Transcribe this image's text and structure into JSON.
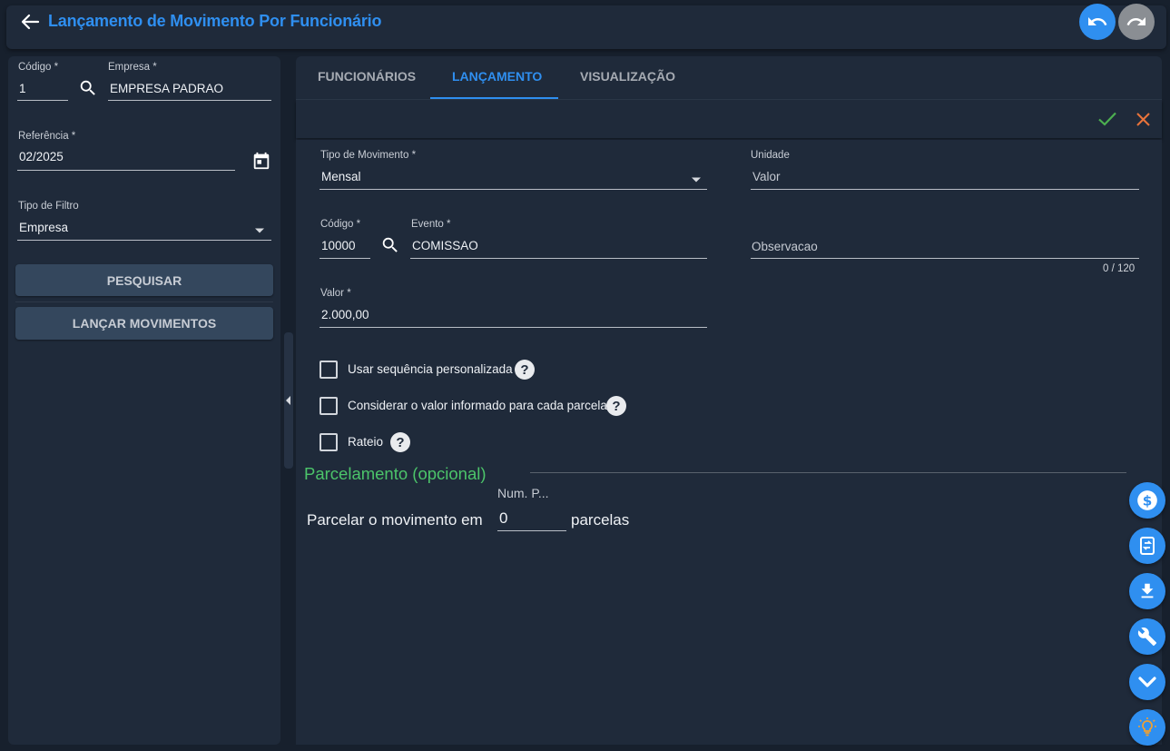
{
  "header": {
    "title": "Lançamento de Movimento Por Funcionário"
  },
  "filters": {
    "codigo_label": "Código *",
    "codigo_value": "1",
    "empresa_label": "Empresa *",
    "empresa_value": "EMPRESA PADRAO",
    "referencia_label": "Referência *",
    "referencia_value": "02/2025",
    "tipo_filtro_label": "Tipo de Filtro",
    "tipo_filtro_value": "Empresa",
    "pesquisar_label": "PESQUISAR",
    "lancar_label": "LANÇAR MOVIMENTOS"
  },
  "tabs": [
    {
      "label": "FUNCIONÁRIOS"
    },
    {
      "label": "LANÇAMENTO"
    },
    {
      "label": "VISUALIZAÇÃO"
    }
  ],
  "form": {
    "tipo_movimento_label": "Tipo de Movimento *",
    "tipo_movimento_value": "Mensal",
    "unidade_label": "Unidade",
    "unidade_value": "Valor",
    "codigo_label": "Código *",
    "codigo_value": "10000",
    "evento_label": "Evento *",
    "evento_value": "COMISSAO",
    "observacao_placeholder": "Observacao",
    "observacao_counter": "0 / 120",
    "valor_label": "Valor *",
    "valor_value": "2.000,00",
    "checkbox_sequencia": "Usar sequência personalizada",
    "checkbox_parcela": "Considerar o valor informado para cada parcela",
    "checkbox_rateio": "Rateio",
    "parcelamento_title": "Parcelamento (opcional)",
    "num_parcelas_label": "Num. P...",
    "parcelar_prefix": "Parcelar o movimento em",
    "num_parcelas_value": "0",
    "parcelar_suffix": "parcelas"
  },
  "colors": {
    "accent": "#2f8ff0",
    "confirm": "#4caf50",
    "cancel": "#e8733a",
    "section_title": "#4cc46a"
  }
}
